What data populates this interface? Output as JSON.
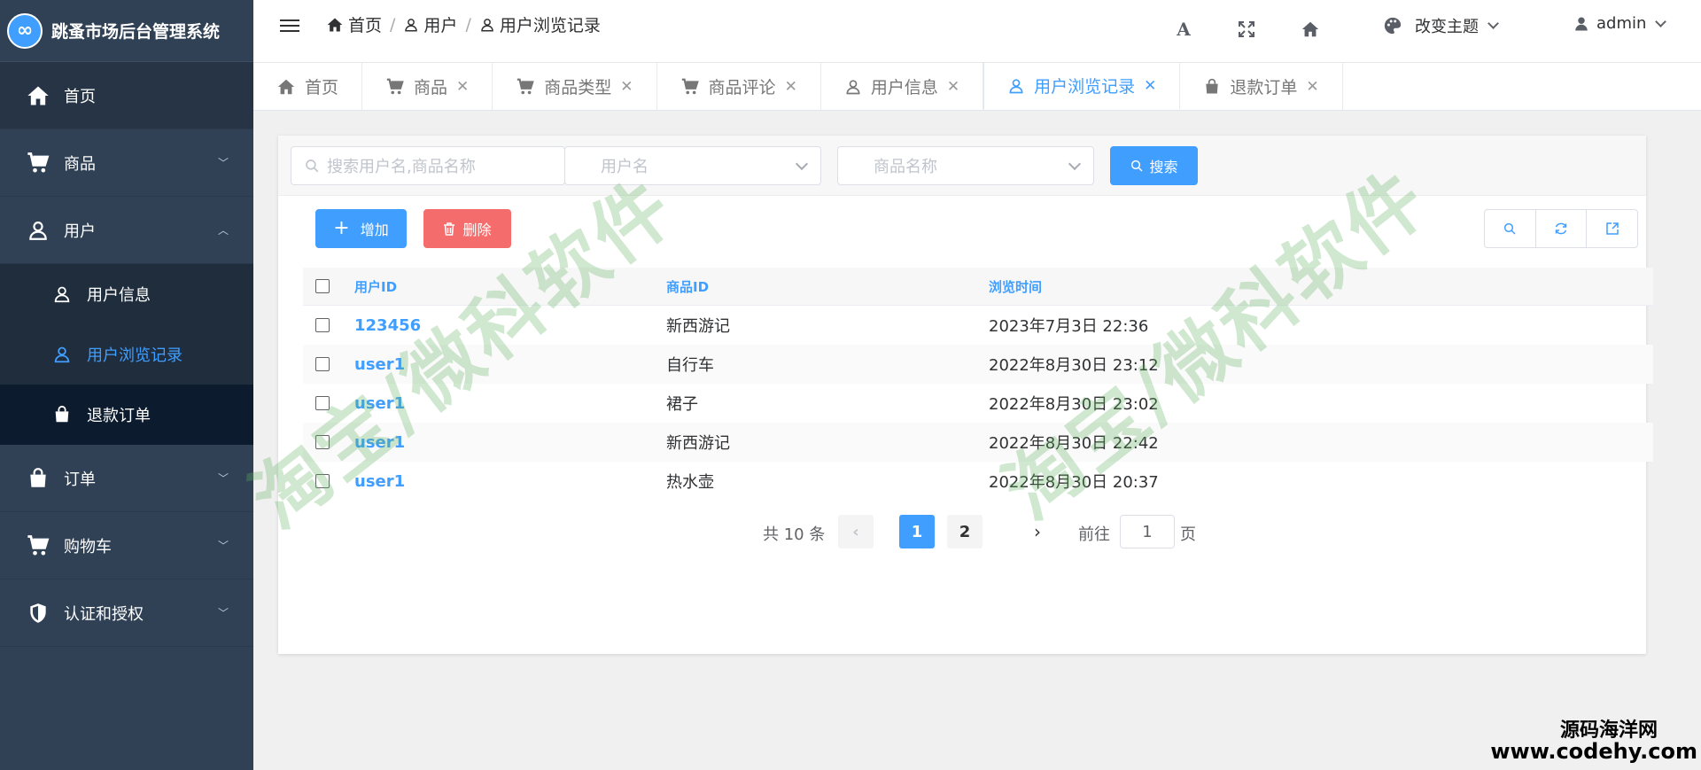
{
  "app": {
    "title": "跳蚤市场后台管理系统",
    "logo_glyph": "∞"
  },
  "sidebar": {
    "items": [
      {
        "label": "首页",
        "icon": "home-icon"
      },
      {
        "label": "商品",
        "icon": "cart-icon"
      },
      {
        "label": "用户",
        "icon": "user-icon",
        "expanded": true,
        "children": [
          {
            "label": "用户信息",
            "icon": "user-icon"
          },
          {
            "label": "用户浏览记录",
            "icon": "user-icon",
            "active": true
          },
          {
            "label": "退款订单",
            "icon": "bag-icon"
          }
        ]
      },
      {
        "label": "订单",
        "icon": "bag-icon"
      },
      {
        "label": "购物车",
        "icon": "cart-icon"
      },
      {
        "label": "认证和授权",
        "icon": "shield-icon"
      }
    ]
  },
  "header": {
    "breadcrumbs": [
      "首页",
      "用户",
      "用户浏览记录"
    ],
    "font_icon": "A",
    "theme_label": "改变主题",
    "user_name": "admin"
  },
  "tabs": [
    {
      "label": "首页",
      "icon": "home-icon"
    },
    {
      "label": "商品",
      "icon": "cart-icon"
    },
    {
      "label": "商品类型",
      "icon": "cart-icon"
    },
    {
      "label": "商品评论",
      "icon": "cart-icon"
    },
    {
      "label": "用户信息",
      "icon": "user-icon"
    },
    {
      "label": "用户浏览记录",
      "icon": "user-icon",
      "active": true
    },
    {
      "label": "退款订单",
      "icon": "bag-icon"
    }
  ],
  "filters": {
    "keyword_placeholder": "搜索用户名,商品名称",
    "username_placeholder": "用户名",
    "product_placeholder": "商品名称",
    "search_label": "搜索"
  },
  "actions": {
    "add_label": "增加",
    "delete_label": "删除"
  },
  "table": {
    "columns": [
      "用户ID",
      "商品ID",
      "浏览时间"
    ],
    "rows": [
      {
        "user_id": "123456",
        "product": "新西游记",
        "time": "2023年7月3日 22:36"
      },
      {
        "user_id": "user1",
        "product": "自行车",
        "time": "2022年8月30日 23:12"
      },
      {
        "user_id": "user1",
        "product": "裙子",
        "time": "2022年8月30日 23:02"
      },
      {
        "user_id": "user1",
        "product": "新西游记",
        "time": "2022年8月30日 22:42"
      },
      {
        "user_id": "user1",
        "product": "热水壶",
        "time": "2022年8月30日 20:37"
      }
    ]
  },
  "pagination": {
    "total_text": "共 10 条",
    "pages": [
      "1",
      "2"
    ],
    "current": "1",
    "goto_label": "前往",
    "goto_value": "1",
    "page_suffix": "页"
  },
  "watermarks": {
    "diagonal": "淘宝/微科软件",
    "corner_cn": "源码海洋网",
    "corner_en": "www.codehy.com"
  },
  "colors": {
    "accent": "#409eff",
    "danger": "#f56c6c",
    "sidebar": "#304156"
  }
}
